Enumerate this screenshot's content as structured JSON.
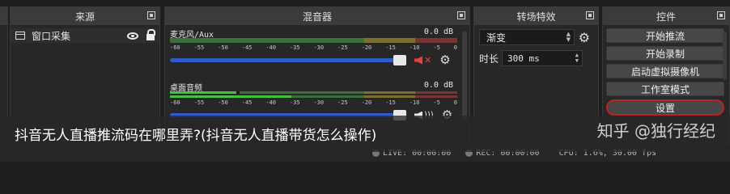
{
  "panels": {
    "sources": {
      "title": "来源",
      "items": [
        {
          "label": "窗口采集"
        }
      ]
    },
    "mixer": {
      "title": "混音器",
      "ticks": [
        "-60",
        "-55",
        "-50",
        "-45",
        "-40",
        "-35",
        "-30",
        "-25",
        "-20",
        "-15",
        "-10",
        "-5",
        "0"
      ],
      "channels": [
        {
          "name": "麦克风/Aux",
          "level": "0.0 dB",
          "muted": true,
          "volume_fraction": 1.0
        },
        {
          "name": "桌面音频",
          "level": "0.0 dB",
          "muted": false,
          "volume_fraction": 1.0
        }
      ]
    },
    "transitions": {
      "title": "转场特效",
      "selected": "渐变",
      "duration_label": "时长",
      "duration_value": "300 ms"
    },
    "controls": {
      "title": "控件",
      "buttons": [
        "开始推流",
        "开始录制",
        "启动虚拟摄像机",
        "工作室模式",
        "设置"
      ]
    }
  },
  "overlay": {
    "caption": "抖音无人直播推流码在哪里弄?(抖音无人直播带货怎么操作)",
    "watermark": "知乎 @独行经纪"
  },
  "status_bar": {
    "live": "LIVE: 00:00:00",
    "rec": "REC: 00:00:00",
    "cpu": "CPU: 1.6%, 30.00 fps"
  },
  "colors": {
    "meter_green": "#3fae3f",
    "meter_yellow": "#a89a2e",
    "meter_red": "#a83a3a",
    "slider_blue": "#2f5cc7",
    "mute_red": "#e84040",
    "highlight_ring": "#b22222"
  }
}
